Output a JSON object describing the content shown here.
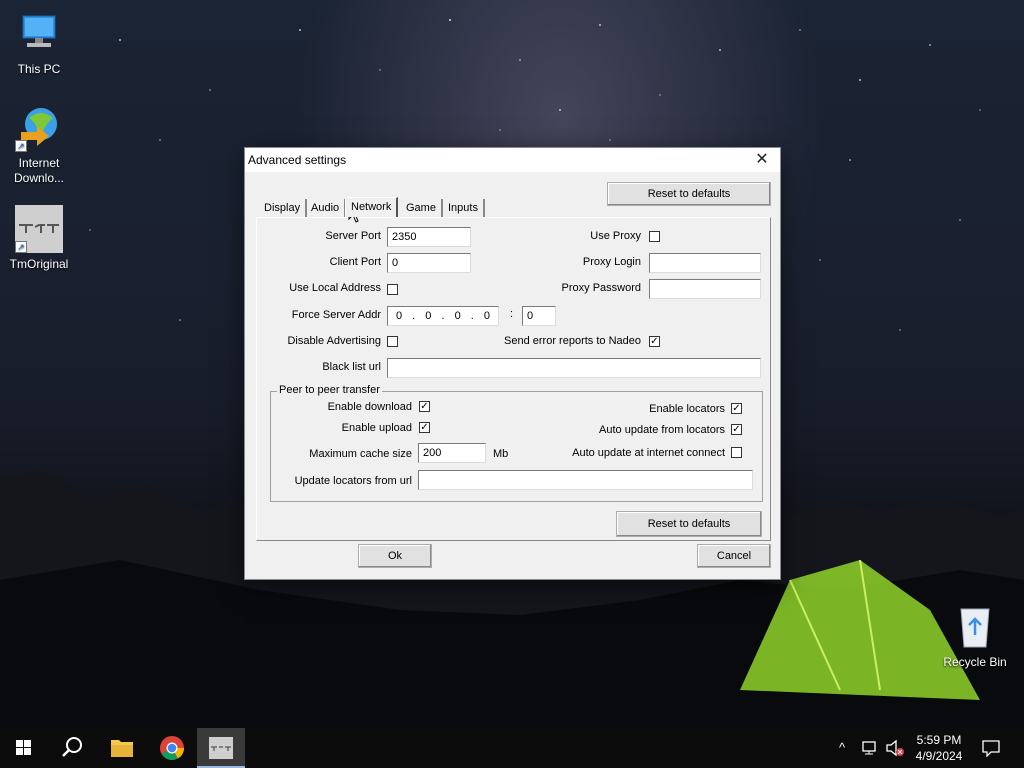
{
  "desktop": {
    "icons": [
      {
        "label": "This PC"
      },
      {
        "label": "Internet Downlo..."
      },
      {
        "label": "TmOriginal"
      },
      {
        "label": "Recycle Bin"
      }
    ]
  },
  "dialog": {
    "title": "Advanced settings",
    "close_glyph": "✕",
    "reset_top_label": "Reset to defaults",
    "tabs": [
      {
        "label": "Display"
      },
      {
        "label": "Audio"
      },
      {
        "label": "Network"
      },
      {
        "label": "Game"
      },
      {
        "label": "Inputs"
      }
    ],
    "active_tab": "Network",
    "network": {
      "server_port_label": "Server Port",
      "server_port_value": "2350",
      "client_port_label": "Client Port",
      "client_port_value": "0",
      "use_local_address_label": "Use Local Address",
      "use_local_address_checked": false,
      "force_server_addr_label": "Force Server Addr",
      "ip_octets": [
        "0",
        "0",
        "0",
        "0"
      ],
      "ip_separator": ".",
      "port_separator": ":",
      "force_server_port_value": "0",
      "disable_advertising_label": "Disable Advertising",
      "disable_advertising_checked": false,
      "black_list_url_label": "Black list url",
      "black_list_url_value": "",
      "use_proxy_label": "Use Proxy",
      "use_proxy_checked": false,
      "proxy_login_label": "Proxy Login",
      "proxy_login_value": "",
      "proxy_password_label": "Proxy Password",
      "proxy_password_value": "",
      "send_error_reports_label": "Send error reports to Nadeo",
      "send_error_reports_checked": true
    },
    "p2p": {
      "group_title": "Peer to peer transfer",
      "enable_download_label": "Enable download",
      "enable_download_checked": true,
      "enable_upload_label": "Enable upload",
      "enable_upload_checked": true,
      "max_cache_label": "Maximum cache size",
      "max_cache_value": "200",
      "max_cache_unit": "Mb",
      "update_locators_label": "Update locators from url",
      "update_locators_value": "",
      "enable_locators_label": "Enable locators",
      "enable_locators_checked": true,
      "auto_update_locators_label": "Auto update from locators",
      "auto_update_locators_checked": true,
      "auto_update_internet_label": "Auto update at internet connect",
      "auto_update_internet_checked": false
    },
    "reset_bottom_label": "Reset to defaults",
    "ok_label": "Ok",
    "cancel_label": "Cancel",
    "check_glyph": "✓"
  },
  "taskbar": {
    "time": "5:59 PM",
    "date": "4/9/2024",
    "tray_chevron": "^"
  },
  "colors": {
    "taskbar_bg": "#0c0c0c",
    "dialog_bg": "#f0f0f0",
    "tent_green": "#8fd42a"
  }
}
